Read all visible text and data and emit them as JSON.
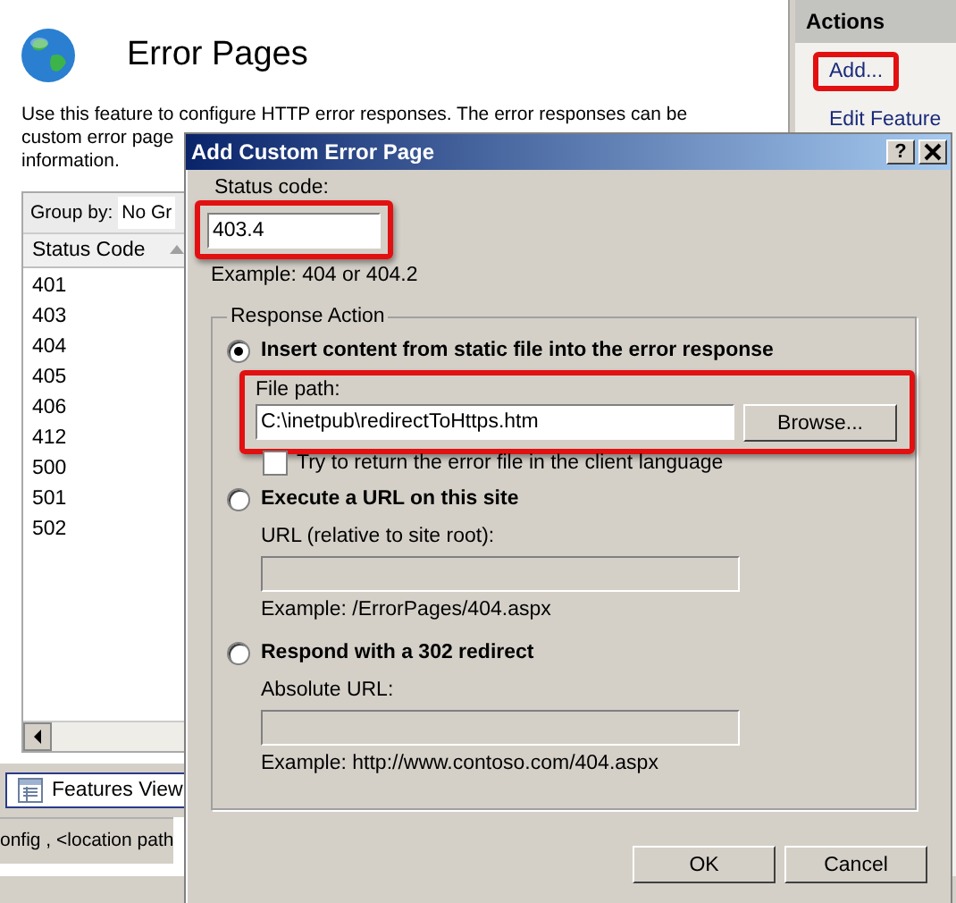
{
  "page": {
    "title": "Error Pages",
    "description_lines": [
      "Use this feature to configure HTTP error responses. The error responses can be",
      "custom error page",
      "information."
    ]
  },
  "toolbar": {
    "group_by_label": "Group by:",
    "group_by_value": "No Gr"
  },
  "table": {
    "columns": [
      {
        "label": "Status Code",
        "sorted": true
      }
    ],
    "rows": [
      "401",
      "403",
      "404",
      "405",
      "406",
      "412",
      "500",
      "501",
      "502"
    ]
  },
  "view_tabs": [
    {
      "label": "Features View",
      "selected": true
    }
  ],
  "status_bar": {
    "text": "onfig , <location path"
  },
  "actions": {
    "title": "Actions",
    "items": [
      {
        "label": "Add...",
        "highlighted": true
      },
      {
        "label": "Edit Feature",
        "highlighted": false
      }
    ]
  },
  "dialog": {
    "title": "Add Custom Error Page",
    "help_button": "?",
    "status_code": {
      "label": "Status code:",
      "value": "403.4",
      "highlighted": true,
      "hint": "Example: 404 or 404.2"
    },
    "response_action": {
      "legend": "Response Action",
      "options": [
        {
          "kind": "file",
          "label": "Insert content from static file into the error response",
          "selected": true,
          "field_label": "File path:",
          "value": "C:\\inetpub\\redirectToHttps.htm",
          "disabled": false,
          "highlighted": true,
          "browse_button": "Browse...",
          "checkbox": {
            "label": "Try to return the error file in the client language",
            "checked": false
          }
        },
        {
          "kind": "url",
          "label": "Execute a URL on this site",
          "selected": false,
          "field_label": "URL (relative to site root):",
          "disabled": true,
          "hint": "Example: /ErrorPages/404.aspx"
        },
        {
          "kind": "url",
          "label": "Respond with a 302 redirect",
          "selected": false,
          "field_label": "Absolute URL:",
          "disabled": true,
          "hint": "Example: http://www.contoso.com/404.aspx"
        }
      ]
    },
    "buttons": [
      "OK",
      "Cancel"
    ]
  }
}
